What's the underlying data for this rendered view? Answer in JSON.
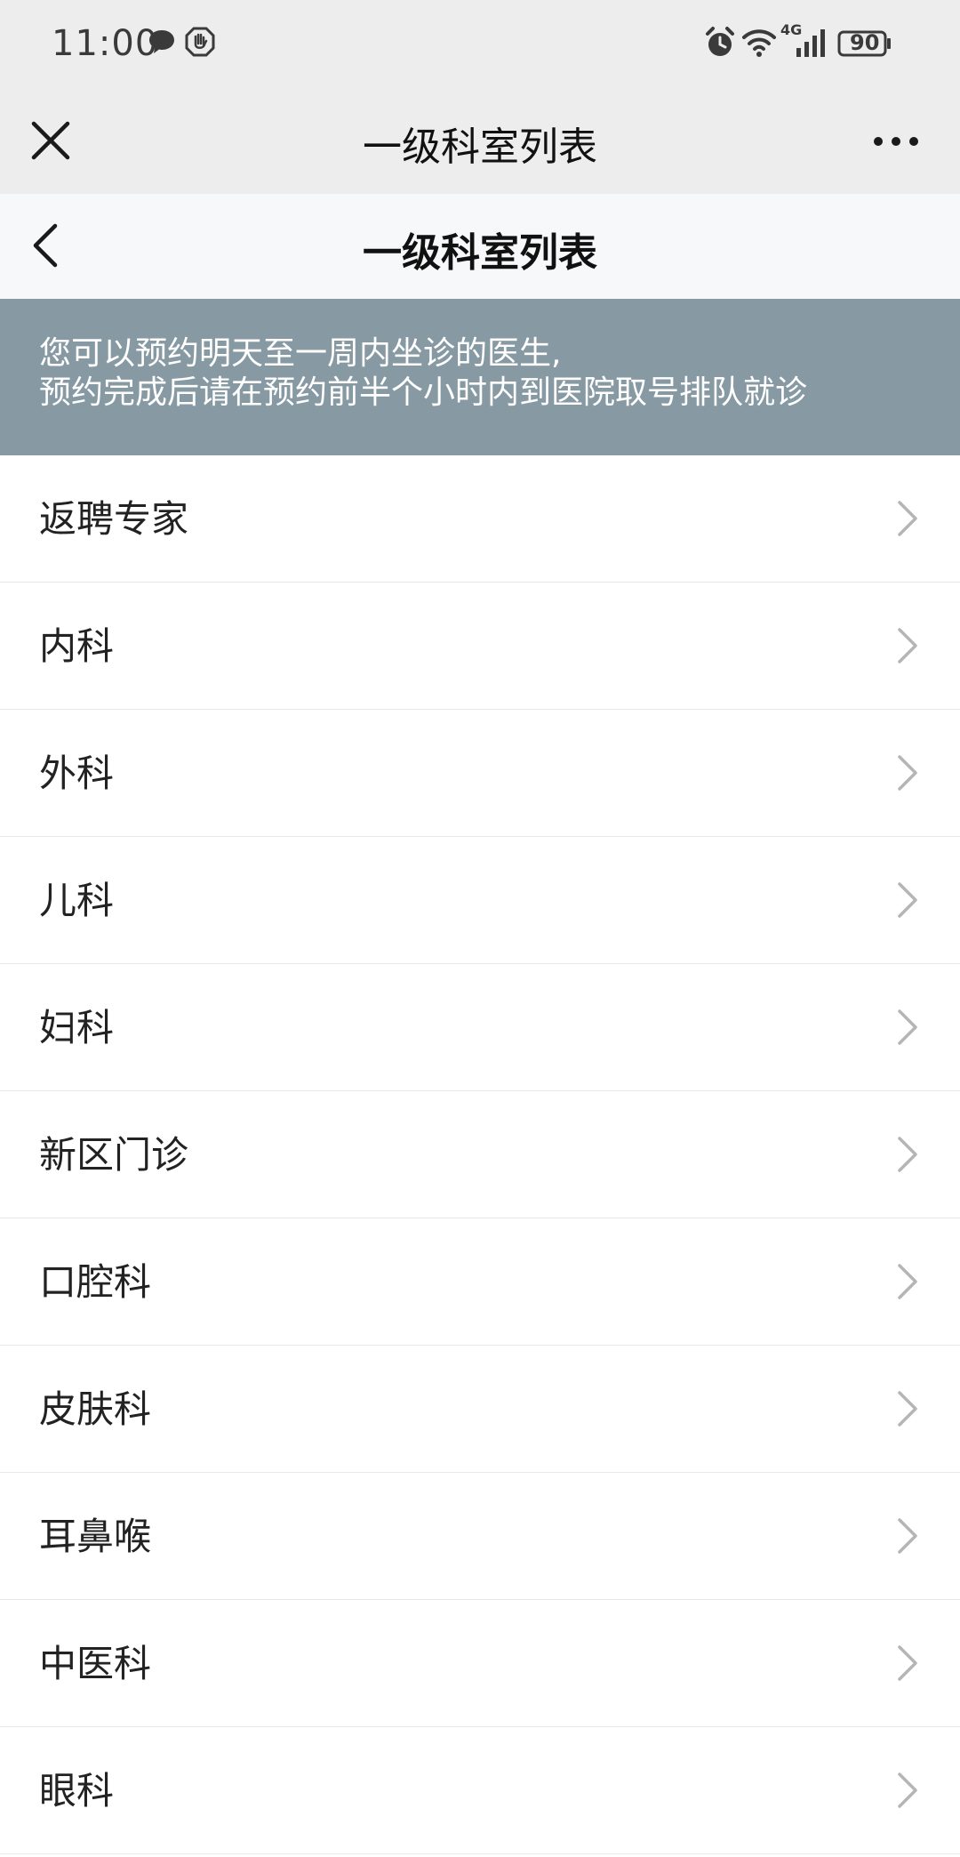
{
  "status_bar": {
    "time": "11:00",
    "battery": "90",
    "network": "4G",
    "icons": [
      "chat-bubble-icon",
      "hand-icon",
      "alarm-icon",
      "wifi-icon",
      "signal-icon",
      "battery-icon"
    ]
  },
  "title_bar": {
    "title": "一级科室列表",
    "close_icon": "close-icon",
    "more_icon": "more-icon"
  },
  "page_header": {
    "title": "一级科室列表",
    "back_icon": "back-chevron-icon"
  },
  "notice": {
    "line1": "您可以预约明天至一周内坐诊的医生,",
    "line2": "预约完成后请在预约前半个小时内到医院取号排队就诊"
  },
  "departments": [
    {
      "label": "返聘专家"
    },
    {
      "label": "内科"
    },
    {
      "label": "外科"
    },
    {
      "label": "儿科"
    },
    {
      "label": "妇科"
    },
    {
      "label": "新区门诊"
    },
    {
      "label": "口腔科"
    },
    {
      "label": "皮肤科"
    },
    {
      "label": "耳鼻喉"
    },
    {
      "label": "中医科"
    },
    {
      "label": "眼科"
    }
  ],
  "colors": {
    "bar_bg": "#ededed",
    "header_bg": "#f7f8f9",
    "notice_bg": "#879aa3",
    "chevron": "#b5b5b5"
  }
}
